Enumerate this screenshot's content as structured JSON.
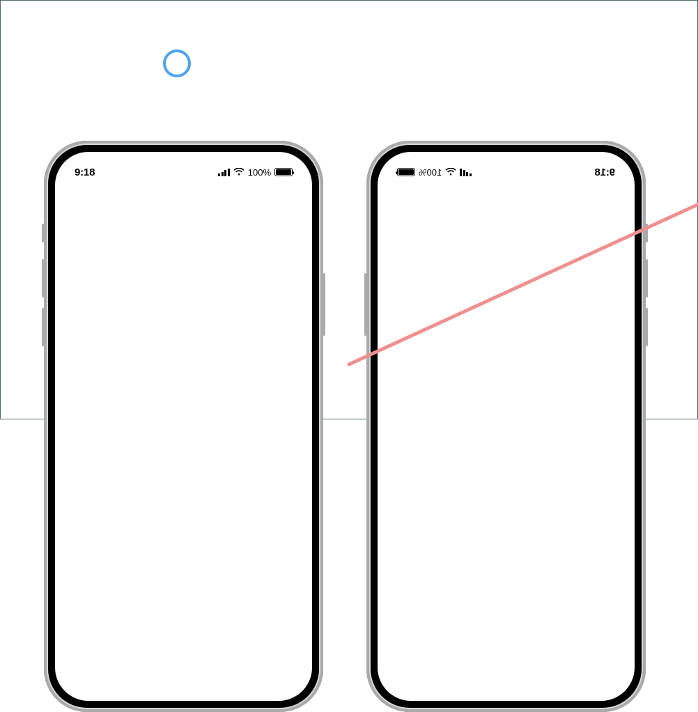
{
  "callout": {
    "ring_color": "#4da3f0"
  },
  "phones": {
    "left": {
      "status": {
        "time": "9:18",
        "battery_percent": "100%",
        "icons": {
          "cell": "cellular-signal-icon",
          "wifi": "wifi-icon",
          "battery": "battery-full-icon"
        }
      },
      "mirrored": false
    },
    "right": {
      "status": {
        "time": "9:18",
        "battery_percent": "100%",
        "icons": {
          "cell": "cellular-signal-icon",
          "wifi": "wifi-icon",
          "battery": "battery-full-icon"
        }
      },
      "mirrored": true
    }
  },
  "annotation": {
    "strike_color": "#f09090"
  }
}
